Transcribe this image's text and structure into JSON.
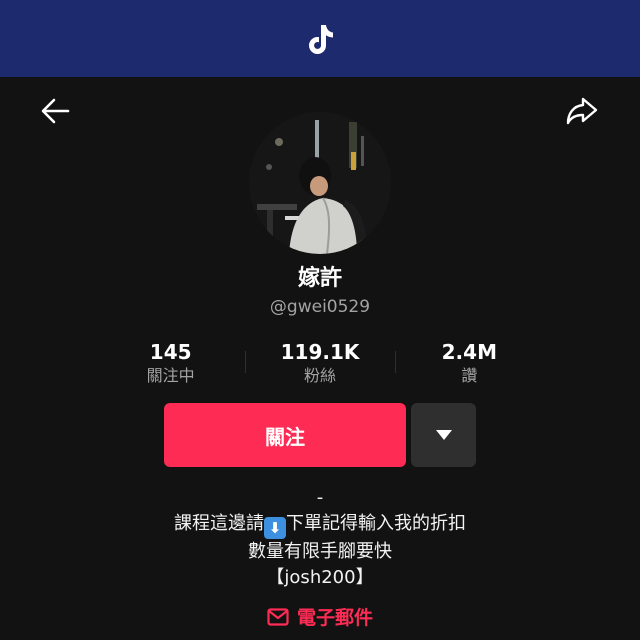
{
  "app": {
    "logo_icon": "tiktok-logo",
    "header_color": "#1e2a6e"
  },
  "nav": {
    "back_icon": "arrow-left-icon",
    "share_icon": "share-arrow-icon"
  },
  "profile": {
    "display_name": "嫁許",
    "handle": "@gwei0529",
    "avatar_desc_icon": "avatar-photo"
  },
  "stats": [
    {
      "value": "145",
      "label": "關注中"
    },
    {
      "value": "119.1K",
      "label": "粉絲"
    },
    {
      "value": "2.4M",
      "label": "讚"
    }
  ],
  "actions": {
    "follow_label": "關注",
    "more_icon": "caret-down-icon",
    "follow_color": "#fe2c55"
  },
  "bio": {
    "line1": "-",
    "line2_before": "課程這邊請",
    "line2_emoji": "⬇",
    "line2_after": "下單記得輸入我的折扣",
    "line3": "數量有限手腳要快",
    "line4": "【josh200】"
  },
  "email": {
    "label": "電子郵件",
    "icon": "envelope-icon"
  }
}
